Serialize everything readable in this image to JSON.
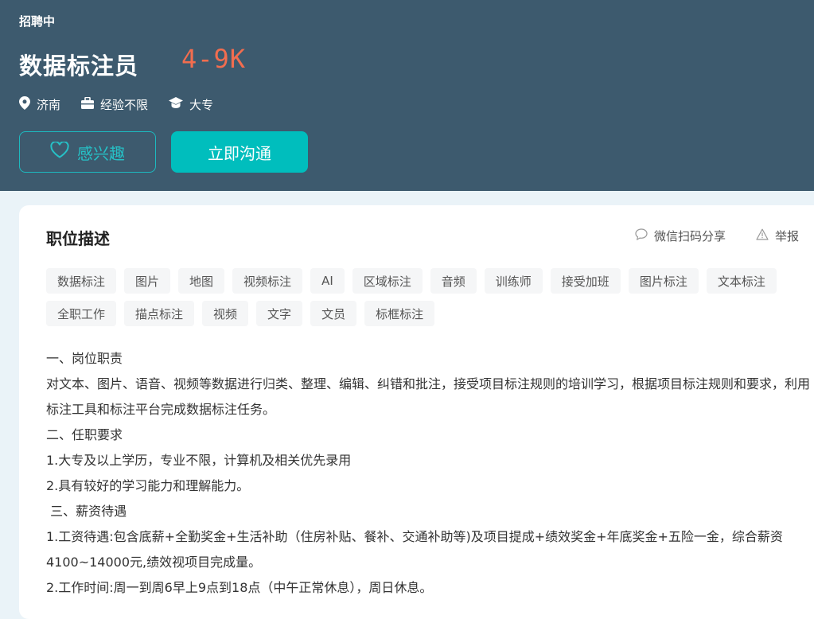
{
  "header": {
    "status": "招聘中",
    "title": "数据标注员",
    "salary": "4-9K",
    "location": "济南",
    "experience": "经验不限",
    "education": "大专",
    "interest_label": "感兴趣",
    "chat_label": "立即沟通"
  },
  "colors": {
    "header_bg": "#3d5a6e",
    "salary": "#f26d4f",
    "accent": "#00bebd"
  },
  "job_detail": {
    "section_title": "职位描述",
    "share_label": "微信扫码分享",
    "report_label": "举报",
    "tags_row1": [
      "数据标注",
      "图片",
      "地图",
      "视频标注",
      "AI",
      "区域标注",
      "音频",
      "训练师",
      "接受加班",
      "图片标注",
      "文本标注"
    ],
    "tags_row2": [
      "全职工作",
      "描点标注",
      "视频",
      "文字",
      "文员",
      "标框标注"
    ],
    "description": [
      "一、岗位职责",
      "对文本、图片、语音、视频等数据进行归类、整理、编辑、纠错和批注，接受项目标注规则的培训学习，根据项目标注规则和要求，利用标注工具和标注平台完成数据标注任务。",
      "二、任职要求",
      "1.大专及以上学历，专业不限，计算机及相关优先录用",
      "2.具有较好的学习能力和理解能力。",
      " 三、薪资待遇",
      "1.工资待遇:包含底薪+全勤奖金+生活补助（住房补贴、餐补、交通补助等)及项目提成+绩效奖金+年底奖金+五险一金，综合薪资4100~14000元,绩效视项目完成量。",
      "2.工作时间:周一到周6早上9点到18点（中午正常休息），周日休息。"
    ]
  }
}
